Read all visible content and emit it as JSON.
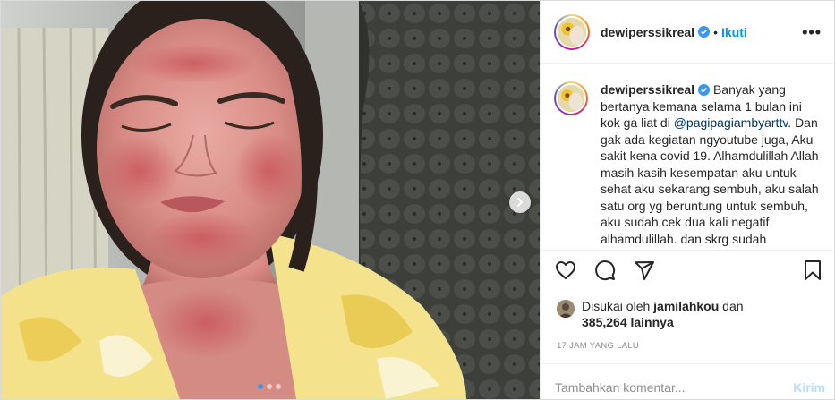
{
  "header": {
    "username": "dewiperssikreal",
    "separator": "•",
    "follow_label": "Ikuti",
    "more_label": "•••"
  },
  "caption": {
    "username": "dewiperssikreal",
    "text_before": "Banyak yang bertanya kemana selama 1 bulan ini kok ga liat di ",
    "mention": "@pagipagiambyarttv",
    "text_after": ". Dan gak ada kegiatan ngyoutube juga, Aku sakit kena covid 19. Alhamdulillah Allah masih kasih kesempatan aku untuk sehat aku sekarang sembuh, aku salah satu org yg beruntung untuk sembuh, aku sudah cek dua kali negatif alhamdulillah. dan skrg sudah"
  },
  "actions": {
    "icons": [
      "heart-icon",
      "comment-icon",
      "share-icon",
      "bookmark-icon"
    ]
  },
  "likes": {
    "prefix": "Disukai oleh ",
    "first_liker": "jamilahkou",
    "middle": " dan",
    "others_count": "385,264 lainnya"
  },
  "timestamp": "17 JAM YANG LALU",
  "comment_box": {
    "placeholder": "Tambahkan komentar...",
    "post_label": "Kirim"
  },
  "carousel": {
    "total_slides": 3,
    "active_slide": 1
  },
  "colors": {
    "link": "#0095f6",
    "post_disabled": "#b2dffc",
    "muted": "#8e8e8e",
    "text": "#262626",
    "dot_active": "#3897f0"
  }
}
